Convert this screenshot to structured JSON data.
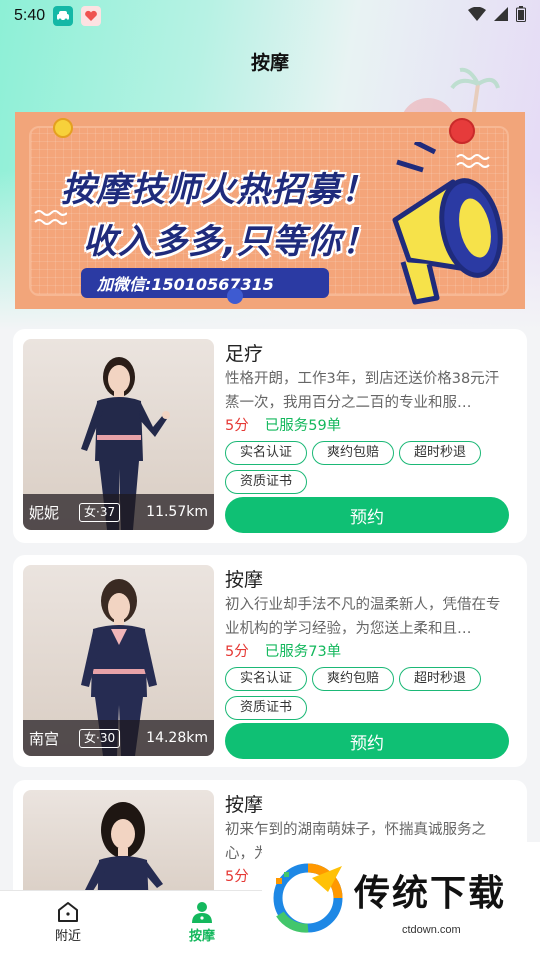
{
  "status_bar": {
    "time": "5:40"
  },
  "header": {
    "title": "按摩"
  },
  "banner": {
    "line1": "按摩技师火热招募！",
    "line2": "收入多多,只等你！",
    "contact": "加微信:15010567315"
  },
  "cards": [
    {
      "title": "足疗",
      "description": "性格开朗，工作3年，到店还送价格38元汗蒸一次，我用百分之二百的专业和服…",
      "rating": "5分",
      "served": "已服务59单",
      "tags": [
        "实名认证",
        "爽约包赔",
        "超时秒退",
        "资质证书"
      ],
      "name": "妮妮",
      "gender_age": "女·37",
      "distance": "11.57km",
      "button": "预约"
    },
    {
      "title": "按摩",
      "description": "初入行业却手法不凡的温柔新人，凭借在专业机构的学习经验，为您送上柔和且…",
      "rating": "5分",
      "served": "已服务73单",
      "tags": [
        "实名认证",
        "爽约包赔",
        "超时秒退",
        "资质证书"
      ],
      "name": "南宫",
      "gender_age": "女·30",
      "distance": "14.28km",
      "button": "预约"
    },
    {
      "title": "按摩",
      "description": "初来乍到的湖南萌妹子，怀揣真诚服务之心，为",
      "rating": "5分"
    }
  ],
  "tab_bar": {
    "tabs": [
      {
        "label": "附近",
        "icon": "home-icon",
        "active": false
      },
      {
        "label": "按摩",
        "icon": "user-icon",
        "active": true
      }
    ]
  },
  "watermark": {
    "brand": "传统下载",
    "url": "ctdown.com"
  },
  "colors": {
    "accent_green": "#0fc074",
    "price_red": "#e53935",
    "banner_orange": "#f4a57a",
    "banner_navy": "#1f2b7c"
  }
}
